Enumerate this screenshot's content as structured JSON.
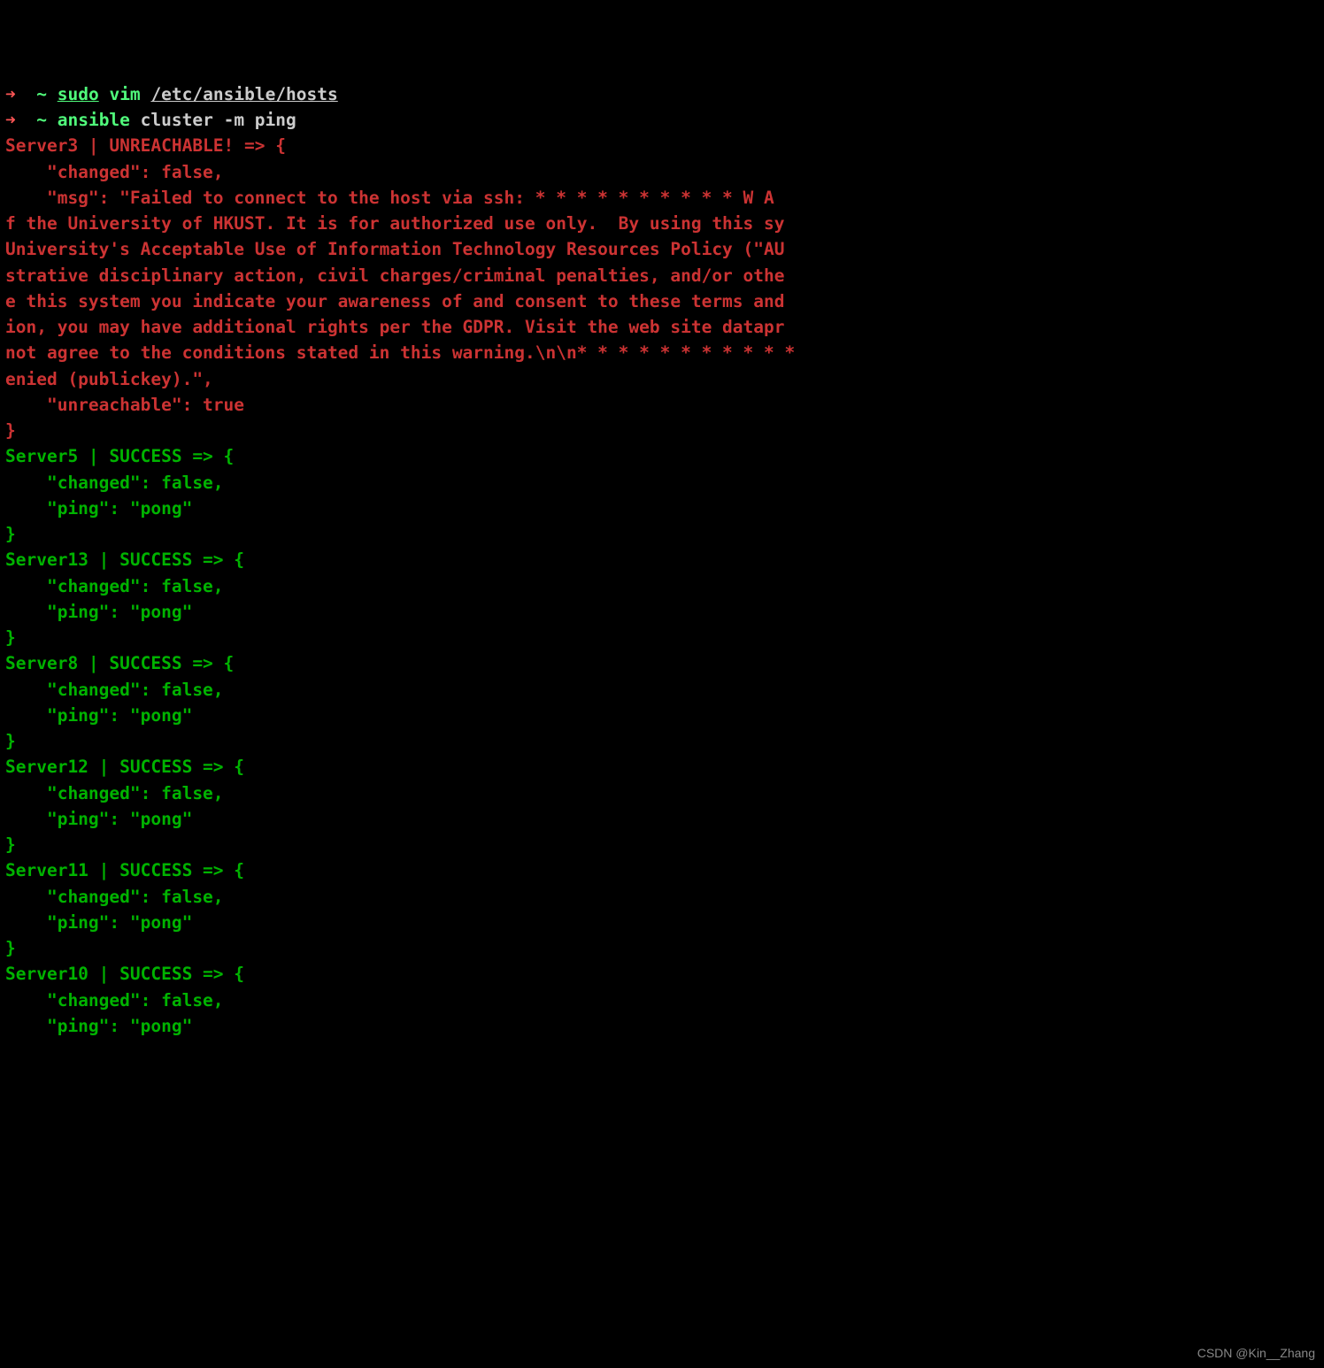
{
  "prompt1": {
    "arrow": "➜",
    "tilde": "~",
    "sudo": "sudo",
    "vim": "vim",
    "path": "/etc/ansible/hosts"
  },
  "prompt2": {
    "arrow": "➜",
    "tilde": "~",
    "ansible": "ansible",
    "args": "cluster -m ping"
  },
  "error": {
    "header": "Server3 | UNREACHABLE! => {",
    "changed": "    \"changed\": false,",
    "msg1": "    \"msg\": \"Failed to connect to the host via ssh: * * * * * * * * * * W A",
    "msg2": "f the University of HKUST. It is for authorized use only.  By using this sy",
    "msg3": "University's Acceptable Use of Information Technology Resources Policy (\"AU",
    "msg4": "strative disciplinary action, civil charges/criminal penalties, and/or othe",
    "msg5": "e this system you indicate your awareness of and consent to these terms and",
    "msg6": "ion, you may have additional rights per the GDPR. Visit the web site datapr",
    "msg7": "not agree to the conditions stated in this warning.\\n\\n* * * * * * * * * * *",
    "msg8": "enied (publickey).\",",
    "unreachable": "    \"unreachable\": true",
    "close": "}"
  },
  "success": [
    {
      "header": "Server5 | SUCCESS => {",
      "changed": "    \"changed\": false,",
      "ping": "    \"ping\": \"pong\"",
      "close": "}"
    },
    {
      "header": "Server13 | SUCCESS => {",
      "changed": "    \"changed\": false,",
      "ping": "    \"ping\": \"pong\"",
      "close": "}"
    },
    {
      "header": "Server8 | SUCCESS => {",
      "changed": "    \"changed\": false,",
      "ping": "    \"ping\": \"pong\"",
      "close": "}"
    },
    {
      "header": "Server12 | SUCCESS => {",
      "changed": "    \"changed\": false,",
      "ping": "    \"ping\": \"pong\"",
      "close": "}"
    },
    {
      "header": "Server11 | SUCCESS => {",
      "changed": "    \"changed\": false,",
      "ping": "    \"ping\": \"pong\"",
      "close": "}"
    },
    {
      "header": "Server10 | SUCCESS => {",
      "changed": "    \"changed\": false,",
      "ping": "    \"ping\": \"pong\""
    }
  ],
  "watermark": "CSDN @Kin__Zhang"
}
